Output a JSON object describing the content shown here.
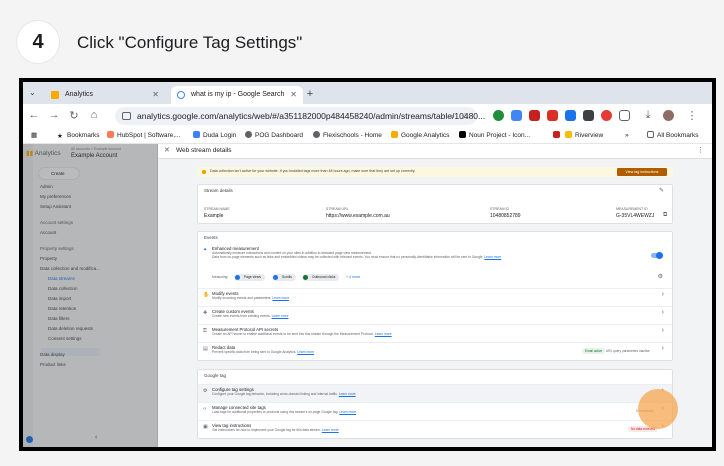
{
  "step": {
    "number": "4",
    "text": "Click \"Configure Tag Settings\""
  },
  "browser": {
    "tabs": [
      {
        "label": "Analytics",
        "active": false
      },
      {
        "label": "what is my ip - Google Search",
        "active": true
      }
    ],
    "url": "analytics.google.com/analytics/web/#/a351182000p484458240/admin/streams/table/10480...",
    "bookmarks": [
      "Bookmarks",
      "HubSpot | Software,...",
      "Duda Login",
      "POG Dashboard",
      "Flexischools - Home",
      "Google Analytics",
      "Noun Project - Icon...",
      "Riverview",
      "All Bookmarks"
    ]
  },
  "ga": {
    "brand": "Analytics",
    "account_small": "All accounts > Example Account",
    "account": "Example Account",
    "create": "Create",
    "nav": [
      "Admin",
      "My preferences",
      "Setup Assistant",
      "Account settings",
      "Account",
      "Property settings",
      "Property",
      "Data collection and modifica...",
      "Data streams",
      "Data collection",
      "Data import",
      "Data retention",
      "Data filters",
      "Data deletion requests",
      "Consent settings",
      "Data display",
      "Product links"
    ],
    "col_header": "Data stream"
  },
  "panel": {
    "title": "Web stream details",
    "alert_text": "Data collection isn't active for your website. If you installed tags more than 48 hours ago, make sure that they are set up correctly.",
    "alert_button": "View tag instructions",
    "stream_details": {
      "heading": "Stream details",
      "name_label": "STREAM NAME",
      "name": "Example",
      "url_label": "STREAM URL",
      "url": "https://www.example.com.au",
      "id_label": "STREAM ID",
      "id": "10480852789",
      "mid_label": "MEASUREMENT ID",
      "mid": "G-35VL4WEWZJ"
    },
    "events": {
      "heading": "Events",
      "enhanced": "Enhanced measurement",
      "enhanced_desc": "Automatically measure interactions and content on your sites in addition to standard page view measurement.",
      "enhanced_desc2": "Data from on-page elements such as links and embedded videos may be collected with relevant events. You must ensure that no personally-identifiable information will be sent to Google.",
      "learn": "Learn more",
      "measuring": "Measuring:",
      "chips": [
        "Page views",
        "Scrolls",
        "Outbound clicks"
      ],
      "more": "+ 4 more",
      "rows": [
        {
          "title": "Modify events",
          "desc": "Modify incoming events and parameters."
        },
        {
          "title": "Create custom events",
          "desc": "Create new events from existing events."
        },
        {
          "title": "Measurement Protocol API secrets",
          "desc": "Create an API secret to enable additional events to be sent into this stream through the Measurement Protocol."
        },
        {
          "title": "Redact data",
          "desc": "Prevent specific data from being sent to Google Analytics."
        }
      ],
      "redact_pill": "Email active",
      "redact_note": "URL query parameters inactive"
    },
    "google_tag": {
      "heading": "Google tag",
      "rows": [
        {
          "title": "Configure tag settings",
          "desc": "Configure your Google tag behavior, including cross-domain linking and internal traffic."
        },
        {
          "title": "Manage connected site tags",
          "desc": "Load tags for additional properties or products using this stream's on-page Google tag."
        },
        {
          "title": "View tag instructions",
          "desc": "Get instructions for how to implement your Google tag for this data stream."
        }
      ],
      "connected_count": "0 connected",
      "no_data": "No data received"
    }
  }
}
